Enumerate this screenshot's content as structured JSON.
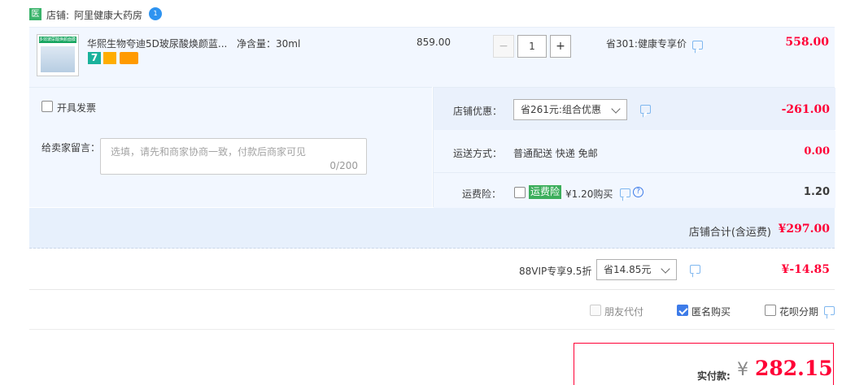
{
  "shop": {
    "label": "店铺:",
    "name": "阿里健康大药房",
    "badge": "医"
  },
  "item": {
    "title": "华熙生物夸迪5D玻尿酸焕颜蓝...",
    "spec": "净含量：30ml",
    "price": "859.00",
    "quantity": "1",
    "discount_text": "省301:健康专享价",
    "total": "558.00",
    "thumb_caption": "多效玻尿酸焕颜面膜",
    "badge_7": "7"
  },
  "invoice": {
    "label": "开具发票"
  },
  "message": {
    "label": "给卖家留言：",
    "placeholder": "选填，请先和商家协商一致，付款后商家可见",
    "counter": "0/200"
  },
  "shop_discount": {
    "label": "店铺优惠：",
    "selected": "省261元:组合优惠",
    "amount": "-261.00"
  },
  "shipping": {
    "label": "运送方式：",
    "method": "普通配送 快递 免邮",
    "amount": "0.00"
  },
  "insurance": {
    "label": "运费险：",
    "tag": "运费险",
    "text": "¥1.20购买",
    "amount": "1.20",
    "help": "?"
  },
  "shop_total": {
    "label": "店铺合计(含运费)",
    "amount": "¥297.00"
  },
  "vip": {
    "label": "88VIP专享9.5折",
    "selected": "省14.85元",
    "amount": "¥-14.85"
  },
  "options": {
    "friend_pay": "朋友代付",
    "anonymous": "匿名购买",
    "installment": "花呗分期"
  },
  "payment": {
    "label": "实付款:",
    "currency": "¥",
    "amount": "282.15"
  },
  "colors": {
    "accent_red": "#ff0036",
    "panel_bg": "#f2f7ff",
    "link_blue": "#3d7be8"
  }
}
